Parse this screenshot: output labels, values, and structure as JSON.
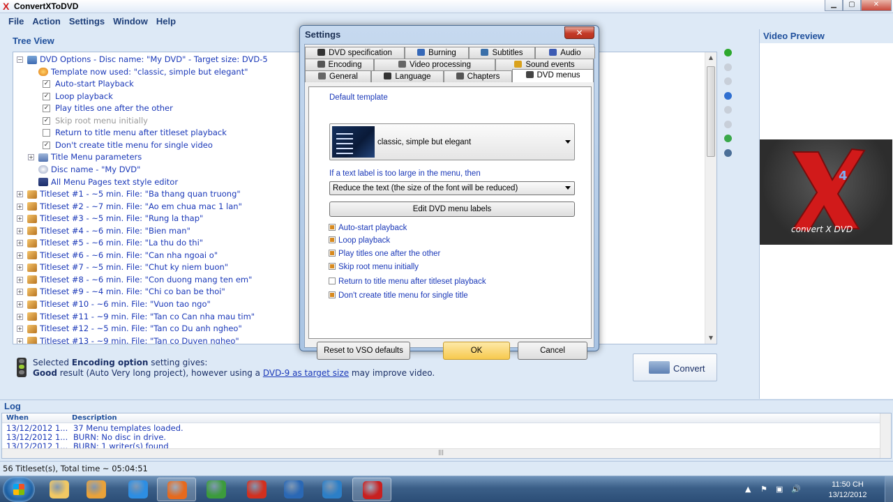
{
  "app": {
    "title": "ConvertXToDVD",
    "logo_glyph": "X"
  },
  "window_buttons": {
    "minimize": "▁",
    "maximize": "▢",
    "close": "✕"
  },
  "menu": [
    "File",
    "Action",
    "Settings",
    "Window",
    "Help"
  ],
  "tree_view": {
    "title": "Tree View",
    "items": [
      {
        "label": "DVD Options - Disc name: \"My DVD\" - Target size: DVD-5",
        "icon": "dvd-options-icon",
        "level": 0,
        "expander": "−"
      },
      {
        "label": "Template now used: \"classic, simple but elegant\"",
        "icon": "template-icon",
        "level": 1
      },
      {
        "label": "Auto-start Playback",
        "checkbox": true,
        "checked": true,
        "level": 1
      },
      {
        "label": "Loop playback",
        "checkbox": true,
        "checked": true,
        "level": 1
      },
      {
        "label": "Play titles one after the other",
        "checkbox": true,
        "checked": true,
        "level": 1
      },
      {
        "label": "Skip root menu initially",
        "checkbox": true,
        "checked": true,
        "level": 1,
        "disabled": true
      },
      {
        "label": "Return to title menu after titleset playback",
        "checkbox": true,
        "checked": false,
        "level": 1
      },
      {
        "label": "Don't create title menu for single video",
        "checkbox": true,
        "checked": true,
        "level": 1
      },
      {
        "label": "Title Menu parameters",
        "icon": "title-menu-icon",
        "level": 1,
        "expander": "+"
      },
      {
        "label": "Disc name - \"My DVD\"",
        "icon": "disc-icon",
        "level": 1
      },
      {
        "label": "All Menu Pages text style editor",
        "icon": "text-style-icon",
        "level": 1
      },
      {
        "label": "Titleset #1 - ~5 min. File: \"Ba thang quan truong\"",
        "icon": "titleset-icon",
        "level": 0,
        "expander": "+"
      },
      {
        "label": "Titleset #2 - ~7 min. File: \"Ao em chua mac 1 lan\"",
        "icon": "titleset-icon",
        "level": 0,
        "expander": "+"
      },
      {
        "label": "Titleset #3 - ~5 min. File: \"Rung la thap\"",
        "icon": "titleset-icon",
        "level": 0,
        "expander": "+"
      },
      {
        "label": "Titleset #4 - ~6 min. File: \"Bien man\"",
        "icon": "titleset-icon",
        "level": 0,
        "expander": "+"
      },
      {
        "label": "Titleset #5 - ~6 min. File: \"La thu do thi\"",
        "icon": "titleset-icon",
        "level": 0,
        "expander": "+"
      },
      {
        "label": "Titleset #6 - ~6 min. File: \"Can nha ngoai o\"",
        "icon": "titleset-icon",
        "level": 0,
        "expander": "+"
      },
      {
        "label": "Titleset #7 - ~5 min. File: \"Chut ky niem buon\"",
        "icon": "titleset-icon",
        "level": 0,
        "expander": "+"
      },
      {
        "label": "Titleset #8 - ~6 min. File: \"Con duong mang ten em\"",
        "icon": "titleset-icon",
        "level": 0,
        "expander": "+"
      },
      {
        "label": "Titleset #9 - ~4 min. File: \"Chi co ban be thoi\"",
        "icon": "titleset-icon",
        "level": 0,
        "expander": "+"
      },
      {
        "label": "Titleset #10 - ~6 min. File: \"Vuon tao ngo\"",
        "icon": "titleset-icon",
        "level": 0,
        "expander": "+"
      },
      {
        "label": "Titleset #11 - ~9 min. File: \"Tan co Can nha mau tim\"",
        "icon": "titleset-icon",
        "level": 0,
        "expander": "+"
      },
      {
        "label": "Titleset #12 - ~5 min. File: \"Tan co Du anh ngheo\"",
        "icon": "titleset-icon",
        "level": 0,
        "expander": "+"
      },
      {
        "label": "Titleset #13 - ~9 min. File: \"Tan co Duyen ngheo\"",
        "icon": "titleset-icon",
        "level": 0,
        "expander": "+"
      }
    ]
  },
  "side_toolbar": [
    {
      "icon": "add-icon",
      "color": "#2ea82e"
    },
    {
      "icon": "edit-icon",
      "color": "#c8cfd9"
    },
    {
      "icon": "remove-icon",
      "color": "#c8cfd9"
    },
    {
      "icon": "info-icon",
      "color": "#2f6fd1"
    },
    {
      "icon": "move-up-icon",
      "color": "#c8cfd9"
    },
    {
      "icon": "move-down-icon",
      "color": "#c8cfd9"
    },
    {
      "icon": "chapter-icon",
      "color": "#3aa84a"
    },
    {
      "icon": "monitor-icon",
      "color": "#4b6f98"
    }
  ],
  "video_preview": {
    "title": "Video Preview",
    "logo_text": "convert X DVD",
    "logo_big": "X",
    "logo_version": "4"
  },
  "info": {
    "line1_prefix": "Selected ",
    "line1_bold": "Encoding option",
    "line1_suffix": " setting gives:",
    "line2_bold": "Good",
    "line2_text": " result (Auto Very long project), however using a ",
    "line2_link": "DVD-9 as target size",
    "line2_suffix": " may improve video."
  },
  "convert_button": "Convert",
  "log": {
    "title": "Log",
    "columns": [
      "When",
      "Description"
    ],
    "rows": [
      {
        "when": "13/12/2012 1...",
        "desc": "37 Menu templates loaded."
      },
      {
        "when": "13/12/2012 1...",
        "desc": "BURN:  No disc in drive."
      },
      {
        "when": "13/12/2012 1...",
        "desc": "BURN: 1 writer(s) found"
      }
    ]
  },
  "status": "56 Titleset(s), Total time ~ 05:04:51",
  "taskbar": {
    "apps": [
      {
        "icon": "explorer-icon",
        "color": "#f1c863"
      },
      {
        "icon": "media-player-icon",
        "color": "#e9a23a"
      },
      {
        "icon": "internet-explorer-icon",
        "color": "#2d8ee3"
      },
      {
        "icon": "firefox-icon",
        "color": "#e66a1e"
      },
      {
        "icon": "chrome-icon",
        "color": "#3c9b3c"
      },
      {
        "icon": "ccleaner-icon",
        "color": "#d2301f"
      },
      {
        "icon": "unikey-icon",
        "color": "#2a68b5"
      },
      {
        "icon": "desktop-icon",
        "color": "#2c7fc7"
      },
      {
        "icon": "convertxtodvd-icon",
        "color": "#c82020"
      }
    ],
    "clock_time": "11:50 CH",
    "clock_date": "13/12/2012",
    "tray_glyphs": [
      "▲",
      "⚑",
      "▣",
      "🔊"
    ]
  },
  "dialog": {
    "title": "Settings",
    "close": "✕",
    "tabs_row1": [
      {
        "label": "DVD specification",
        "icon": "dvd-spec-icon",
        "color": "#333"
      },
      {
        "label": "Burning",
        "icon": "burning-icon",
        "color": "#3568b8"
      },
      {
        "label": "Subtitles",
        "icon": "subtitles-icon",
        "color": "#3a6fa9"
      },
      {
        "label": "Audio",
        "icon": "audio-icon",
        "color": "#3d5bb3"
      }
    ],
    "tabs_row2": [
      {
        "label": "Encoding",
        "icon": "encoding-icon",
        "color": "#555"
      },
      {
        "label": "Video processing",
        "icon": "video-processing-icon",
        "color": "#666"
      },
      {
        "label": "Sound events",
        "icon": "sound-events-icon",
        "color": "#d9a11c"
      }
    ],
    "tabs_row3": [
      {
        "label": "General",
        "icon": "general-icon",
        "color": "#666"
      },
      {
        "label": "Language",
        "icon": "language-icon",
        "color": "#333"
      },
      {
        "label": "Chapters",
        "icon": "chapters-icon",
        "color": "#555"
      },
      {
        "label": "DVD menus",
        "icon": "dvd-menus-icon",
        "color": "#444",
        "selected": true
      }
    ],
    "default_template_label": "Default template",
    "template_value": "classic, simple but elegant",
    "text_label_rule": "If a text label is too large in the menu, then",
    "text_label_option": "Reduce the text (the size of the font will be reduced)",
    "edit_labels_button": "Edit DVD menu labels",
    "options": [
      {
        "label": "Auto-start playback",
        "checked": true
      },
      {
        "label": "Loop playback",
        "checked": true
      },
      {
        "label": "Play titles one after the other",
        "checked": true
      },
      {
        "label": "Skip root menu initially",
        "checked": true
      },
      {
        "label": "Return to title menu after titleset playback",
        "checked": false
      },
      {
        "label": "Don't create title menu for single title",
        "checked": true
      }
    ],
    "reset_button": "Reset to VSO defaults",
    "ok_button": "OK",
    "cancel_button": "Cancel"
  }
}
